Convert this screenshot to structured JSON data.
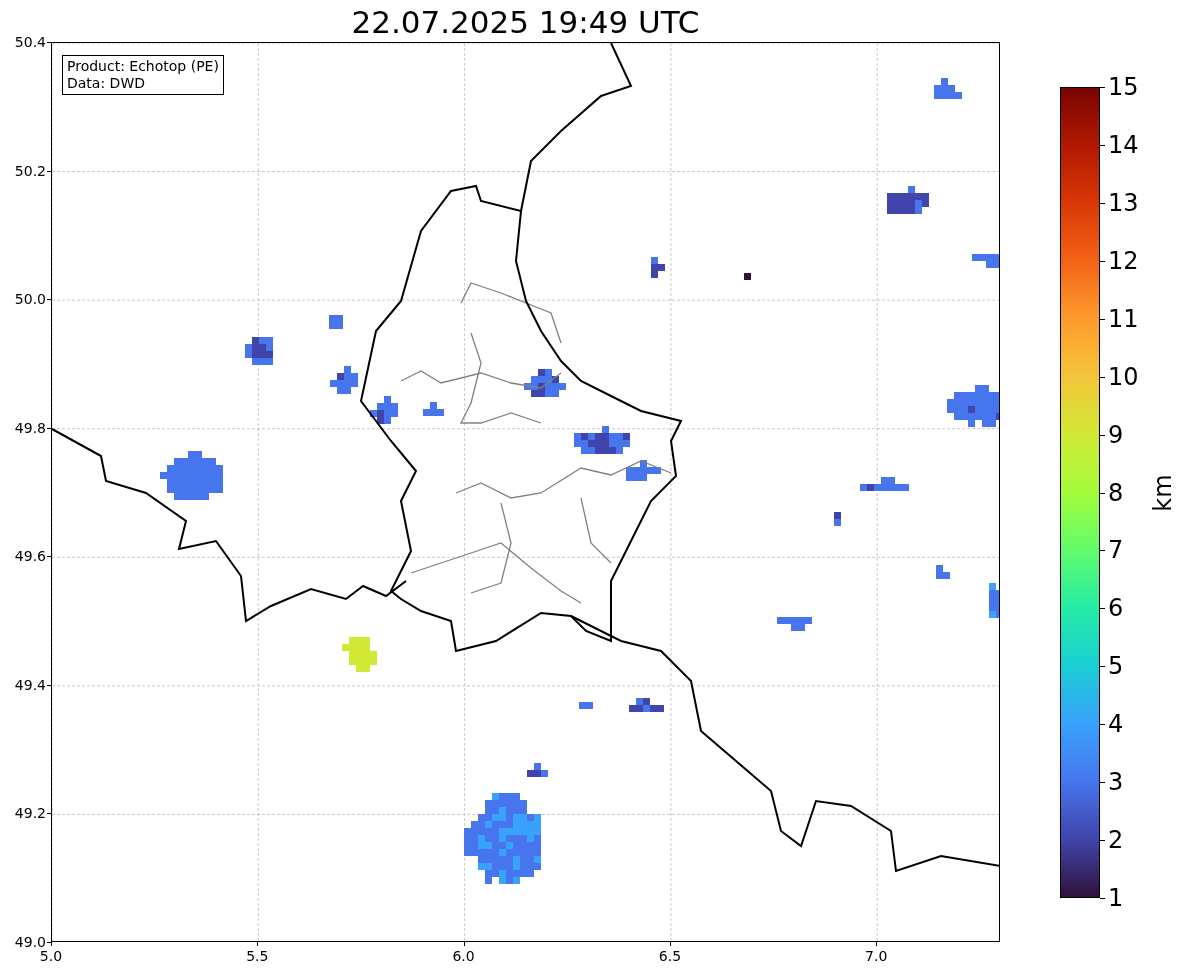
{
  "title": "22.07.2025 19:49 UTC",
  "info_box": {
    "lines": [
      "Product: Echotop (PE)",
      "Data: DWD"
    ]
  },
  "x_ticks": [
    "5.0",
    "5.5",
    "6.0",
    "6.5",
    "7.0"
  ],
  "y_ticks": [
    "50.4",
    "50.2",
    "50.0",
    "49.8",
    "49.6",
    "49.4",
    "49.2",
    "49.0"
  ],
  "colorbar": {
    "label": "km",
    "ticks": [
      "15",
      "14",
      "13",
      "12",
      "11",
      "10",
      "9",
      "8",
      "7",
      "6",
      "5",
      "4",
      "3",
      "2",
      "1"
    ]
  }
}
